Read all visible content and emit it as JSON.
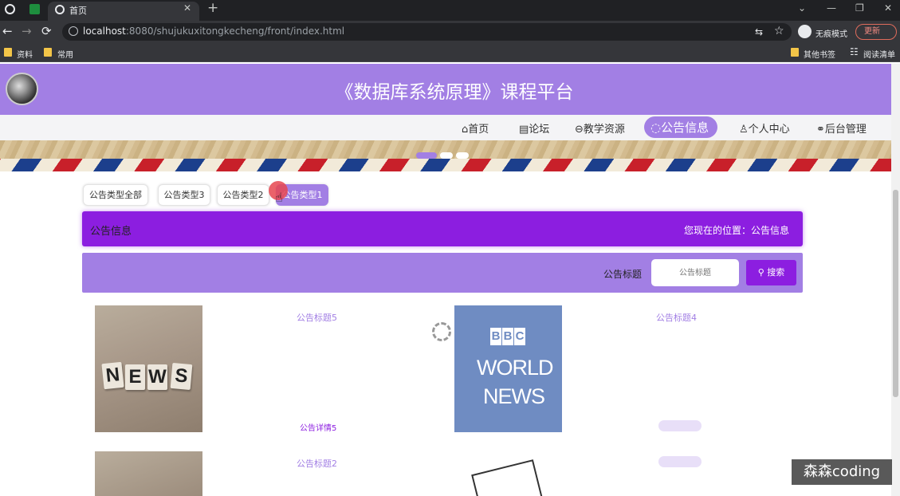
{
  "browser": {
    "tab_title": "首页",
    "url_host": "localhost",
    "url_rest": ":8080/shujukuxitongkecheng/front/index.html",
    "incognito_label": "无痕模式",
    "update_label": "更新",
    "bookmarks": [
      "资料",
      "常用"
    ],
    "bookmarks_right": [
      "其他书签",
      "阅读清单"
    ]
  },
  "site": {
    "title": "《数据库系统原理》课程平台",
    "nav": [
      "首页",
      "论坛",
      "教学资源",
      "公告信息",
      "个人中心",
      "后台管理"
    ],
    "nav_active_label": "公告信息"
  },
  "categories": [
    "公告类型全部",
    "公告类型3",
    "公告类型2",
    "公告类型1"
  ],
  "section": {
    "title": "公告信息",
    "location": "您现在的位置：公告信息"
  },
  "search": {
    "label": "公告标题",
    "placeholder": "公告标题",
    "button": "搜索"
  },
  "news": [
    {
      "title": "公告标题5",
      "detail": "公告详情5"
    },
    {
      "title": "公告标题4"
    },
    {
      "title": "公告标题2"
    }
  ],
  "thumbs": {
    "news_letters": [
      "N",
      "E",
      "W",
      "S"
    ],
    "bbc_letters": [
      "B",
      "B",
      "C"
    ],
    "bbc_line1": "WORLD",
    "bbc_line2": "NEWS"
  },
  "watermark": "森森coding",
  "colors": {
    "accent": "#a27fe4",
    "accent_dark": "#8c1ee0"
  }
}
